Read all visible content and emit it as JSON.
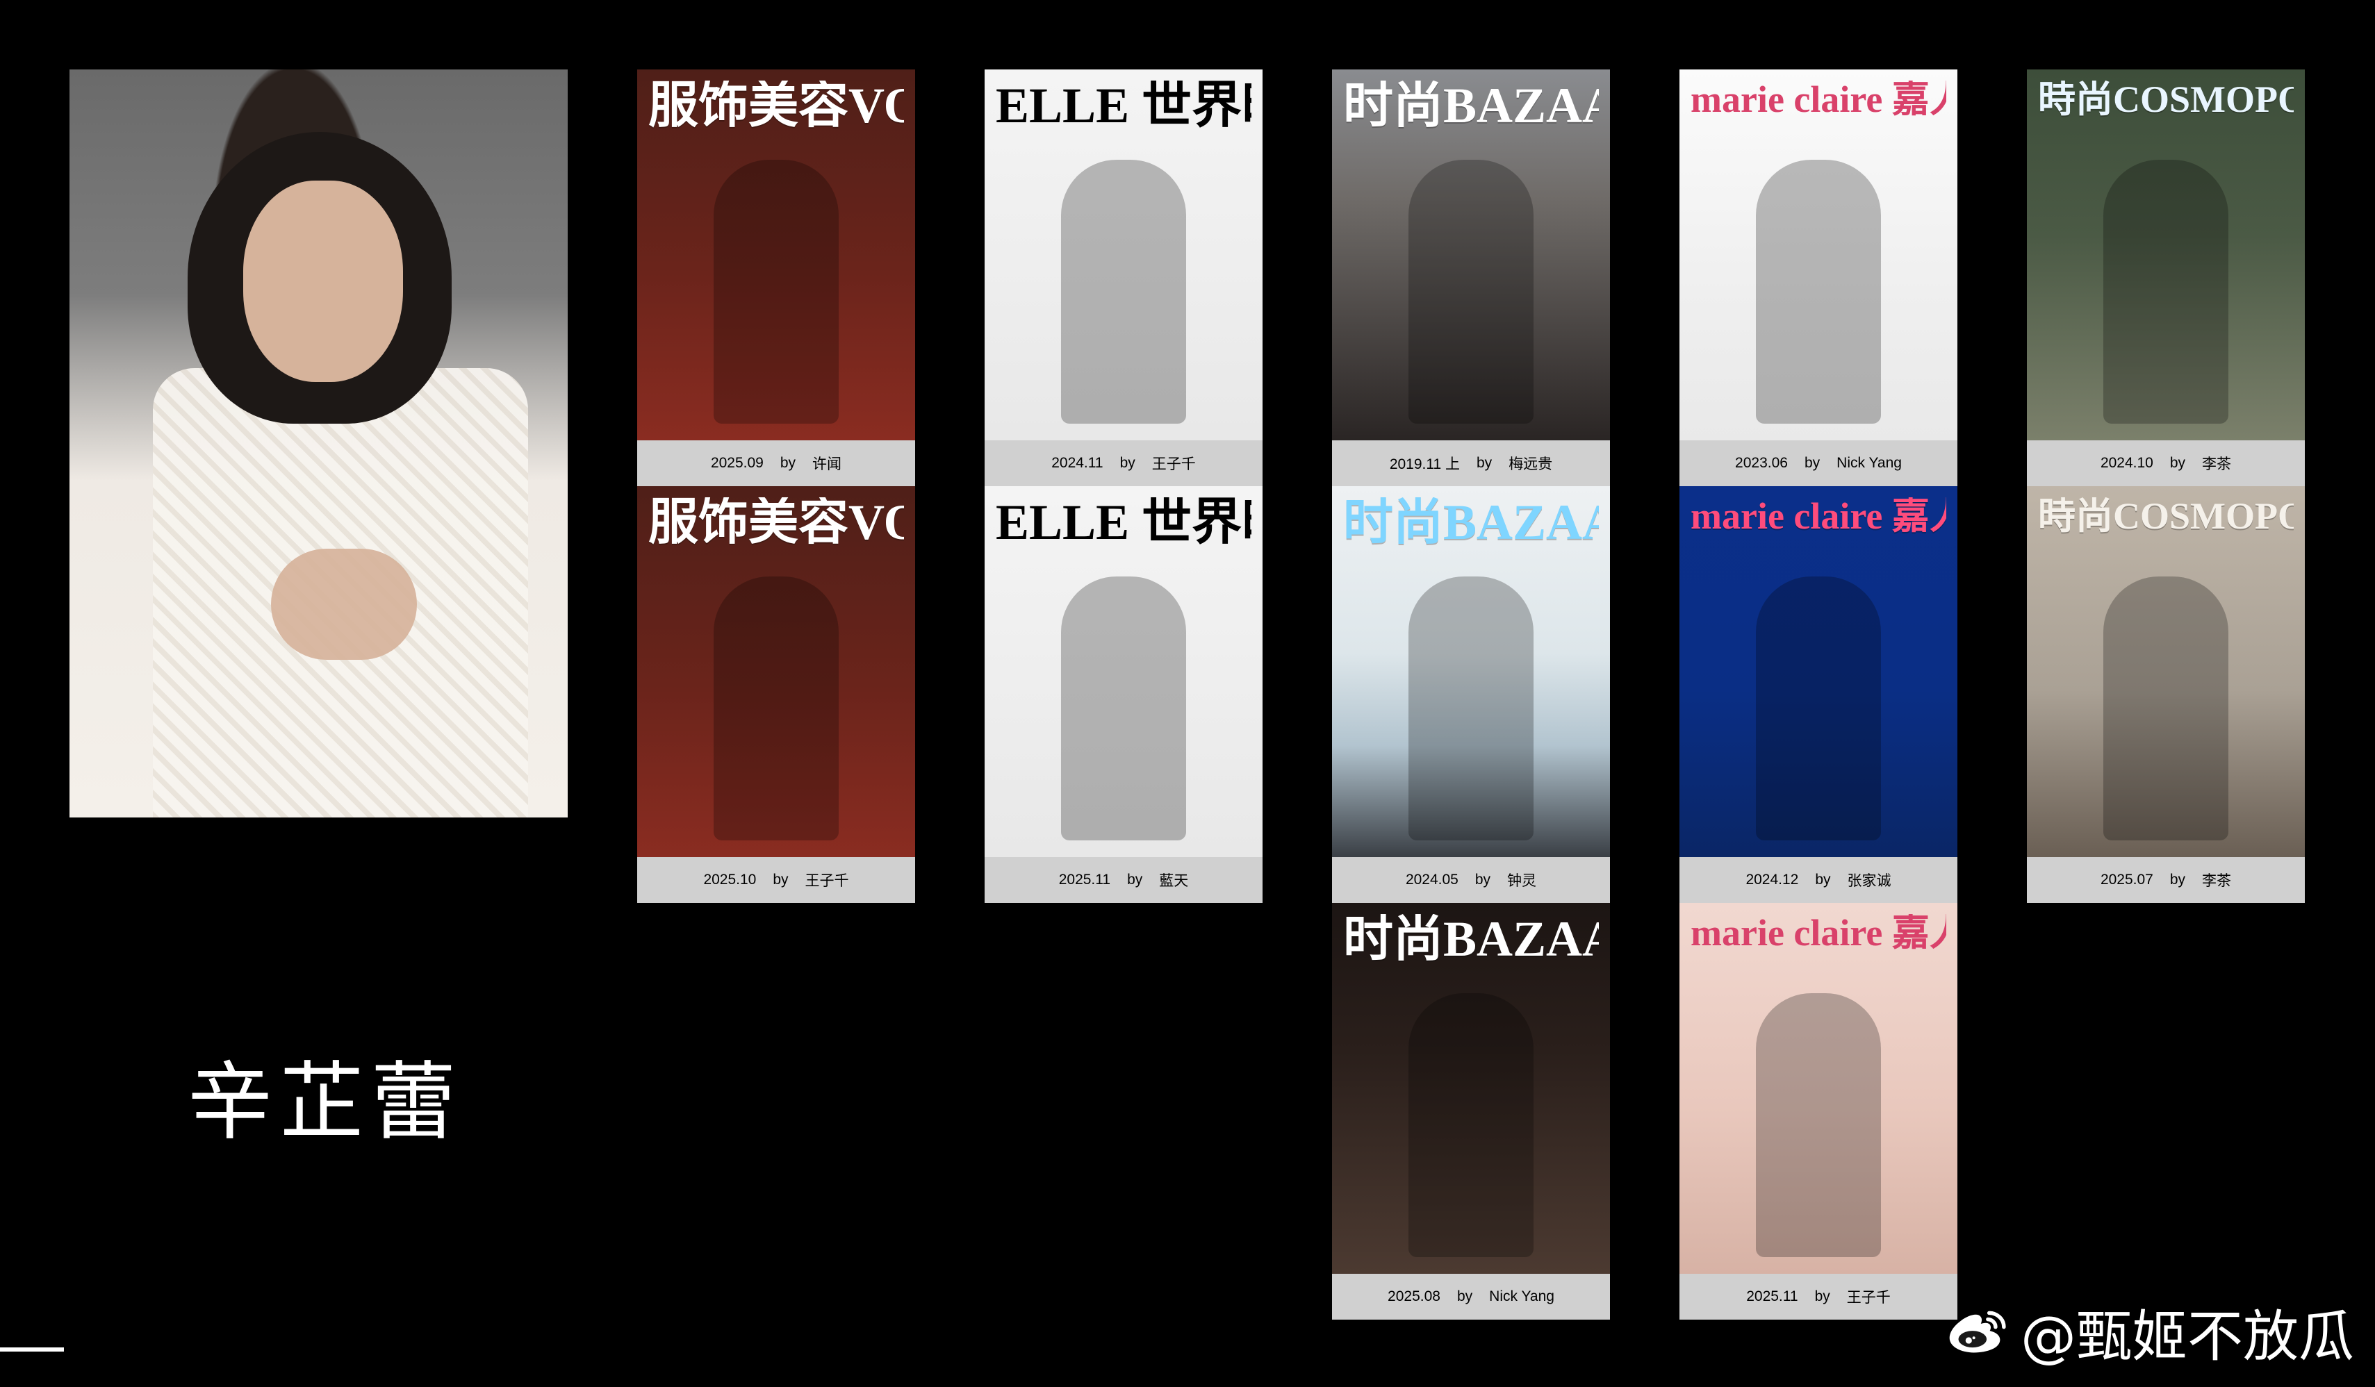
{
  "subject": {
    "name": "辛芷蕾"
  },
  "covers": [
    {
      "masthead": "服饰美容VOGUE",
      "date": "2025.09",
      "by_label": "by",
      "photographer": "许闻",
      "theme": "t-vogue-red"
    },
    {
      "masthead": "ELLE 世界时装之苑",
      "date": "2024.11",
      "by_label": "by",
      "photographer": "王子千",
      "theme": "t-elle-white"
    },
    {
      "masthead": "时尚BAZAAR 芭莎",
      "date": "2019.11 上",
      "by_label": "by",
      "photographer": "梅远贵",
      "theme": "t-bazaar-city"
    },
    {
      "masthead": "marie claire 嘉人",
      "date": "2023.06",
      "by_label": "by",
      "photographer": "Nick Yang",
      "theme": "t-marie-white"
    },
    {
      "masthead": "時尚COSMOPOLITAN",
      "date": "2024.10",
      "by_label": "by",
      "photographer": "李茶",
      "theme": "t-cosmo-green"
    },
    {
      "masthead": "服饰美容VOGUE",
      "date": "2025.10",
      "by_label": "by",
      "photographer": "王子千",
      "theme": "t-vogue-red"
    },
    {
      "masthead": "ELLE 世界时装之苑",
      "date": "2025.11",
      "by_label": "by",
      "photographer": "藍天",
      "theme": "t-elle-white"
    },
    {
      "masthead": "时尚BAZAAR 芭莎",
      "date": "2024.05",
      "by_label": "by",
      "photographer": "钟灵",
      "theme": "t-bazaar-sea"
    },
    {
      "masthead": "marie claire 嘉人",
      "date": "2024.12",
      "by_label": "by",
      "photographer": "张家诚",
      "theme": "t-marie-blue"
    },
    {
      "masthead": "時尚COSMOPOLITAN",
      "date": "2025.07",
      "by_label": "by",
      "photographer": "李茶",
      "theme": "t-cosmo-room"
    },
    {
      "masthead": "时尚BAZAAR 芭莎",
      "date": "2025.08",
      "by_label": "by",
      "photographer": "Nick Yang",
      "theme": "t-bazaar-dark"
    },
    {
      "masthead": "marie claire 嘉人",
      "date": "2025.11",
      "by_label": "by",
      "photographer": "王子千",
      "theme": "t-marie-pink"
    }
  ],
  "watermark": {
    "text": "@甄姬不放瓜",
    "icon": "weibo-icon"
  }
}
